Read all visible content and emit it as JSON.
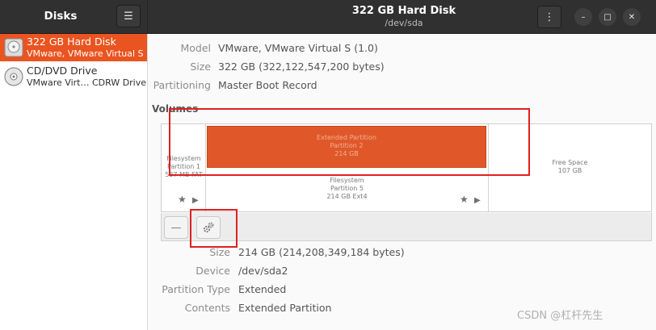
{
  "header": {
    "app_title": "Disks",
    "menu_icon": "hamburger-menu-icon",
    "window_title": "322 GB Hard Disk",
    "window_subtitle": "/dev/sda",
    "kebab_icon": "kebab-menu-icon"
  },
  "sidebar": {
    "items": [
      {
        "name": "322 GB Hard Disk",
        "description": "VMware, VMware Virtual S",
        "icon": "hard-disk-icon",
        "selected": true
      },
      {
        "name": "CD/DVD Drive",
        "description": "VMware Virt… CDRW Drive",
        "icon": "optical-disc-icon",
        "selected": false
      }
    ]
  },
  "disk_info": {
    "model_label": "Model",
    "model_value": "VMware, VMware Virtual S (1.0)",
    "size_label": "Size",
    "size_value": "322 GB (322,122,547,200 bytes)",
    "partitioning_label": "Partitioning",
    "partitioning_value": "Master Boot Record"
  },
  "volumes": {
    "heading": "Volumes",
    "partition1": {
      "line1": "Filesystem",
      "line2": "Partition 1",
      "line3": "537 MB FAT"
    },
    "extended": {
      "line1": "Extended Partition",
      "line2": "Partition 2",
      "line3": "214 GB"
    },
    "partition5": {
      "line1": "Filesystem",
      "line2": "Partition 5",
      "line3": "214 GB Ext4"
    },
    "free": {
      "line1": "Free Space",
      "line2": "107 GB"
    }
  },
  "toolbar": {
    "remove_label": "—",
    "settings_icon": "gears-icon"
  },
  "selected_volume": {
    "size_label": "Size",
    "size_value": "214 GB (214,208,349,184 bytes)",
    "device_label": "Device",
    "device_value": "/dev/sda2",
    "ptype_label": "Partition Type",
    "ptype_value": "Extended",
    "contents_label": "Contents",
    "contents_value": "Extended Partition"
  },
  "watermark": "CSDN @杠杆先生",
  "colors": {
    "accent": "#e95420",
    "annotation": "#e02020",
    "header_bg": "#303030"
  }
}
